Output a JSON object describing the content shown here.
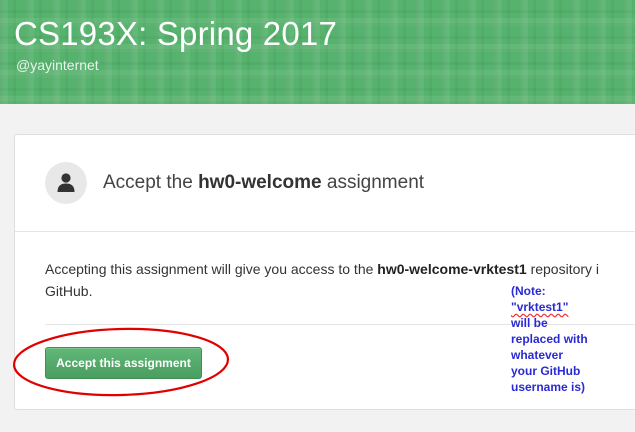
{
  "header": {
    "org_title": "CS193X: Spring 2017",
    "org_handle": "@yayinternet",
    "background_color": "#56b36d"
  },
  "card": {
    "title_prefix": "Accept the ",
    "assignment_name": "hw0-welcome",
    "title_suffix": " assignment",
    "avatar_icon": "person-icon",
    "body_prefix": "Accepting this assignment will give you access to the ",
    "repository_name": "hw0-welcome-vrktest1",
    "body_suffix": " repository i",
    "body_line2": "GitHub.",
    "accept_button_label": "Accept this assignment",
    "accept_button_color": "#4fa865"
  },
  "annotation": {
    "note_lines": [
      "(Note:",
      "\"vrktest1\"",
      "will be",
      "replaced with",
      "whatever",
      "your GitHub",
      "username is)"
    ],
    "note_color": "#2a2ad4",
    "circle_color": "#e00000"
  }
}
